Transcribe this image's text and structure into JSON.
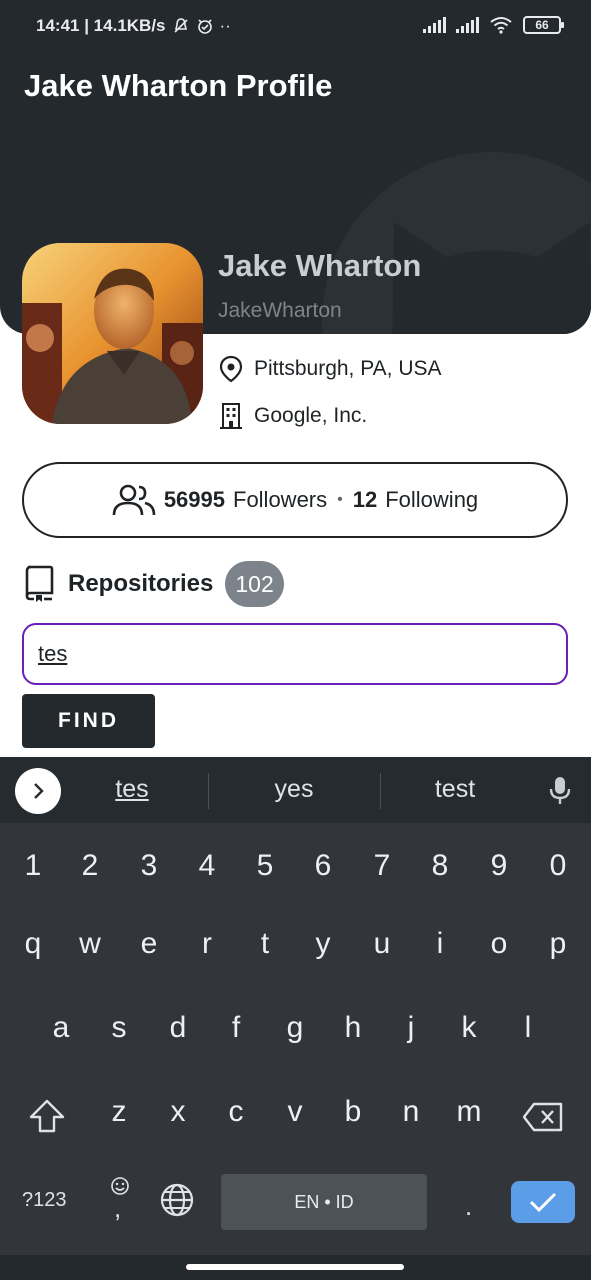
{
  "status_bar": {
    "time_speed": "14:41 | 14.1KB/s",
    "extra": "··",
    "battery": "66"
  },
  "app_bar": {
    "title": "Jake Wharton Profile"
  },
  "profile": {
    "name": "Jake Wharton",
    "username": "JakeWharton",
    "location": "Pittsburgh, PA, USA",
    "company": "Google, Inc."
  },
  "stats": {
    "followers_count": "56995",
    "followers_label": "Followers",
    "separator": "•",
    "following_count": "12",
    "following_label": "Following"
  },
  "repositories": {
    "label": "Repositories",
    "count": "102"
  },
  "search": {
    "value": "tes"
  },
  "find_button": {
    "label": "FIND"
  },
  "keyboard": {
    "suggestions": [
      "tes",
      "yes",
      "test"
    ],
    "number_row": [
      "1",
      "2",
      "3",
      "4",
      "5",
      "6",
      "7",
      "8",
      "9",
      "0"
    ],
    "row1": [
      "q",
      "w",
      "e",
      "r",
      "t",
      "y",
      "u",
      "i",
      "o",
      "p"
    ],
    "row2": [
      "a",
      "s",
      "d",
      "f",
      "g",
      "h",
      "j",
      "k",
      "l"
    ],
    "row3": [
      "z",
      "x",
      "c",
      "v",
      "b",
      "n",
      "m"
    ],
    "symbols_key": "?123",
    "comma_key": ",",
    "space_label": "EN • ID",
    "period_key": "."
  },
  "colors": {
    "header": "#24292e",
    "input_focus": "#6a1fb8",
    "badge": "#7c838a",
    "enter": "#5b9de6"
  }
}
